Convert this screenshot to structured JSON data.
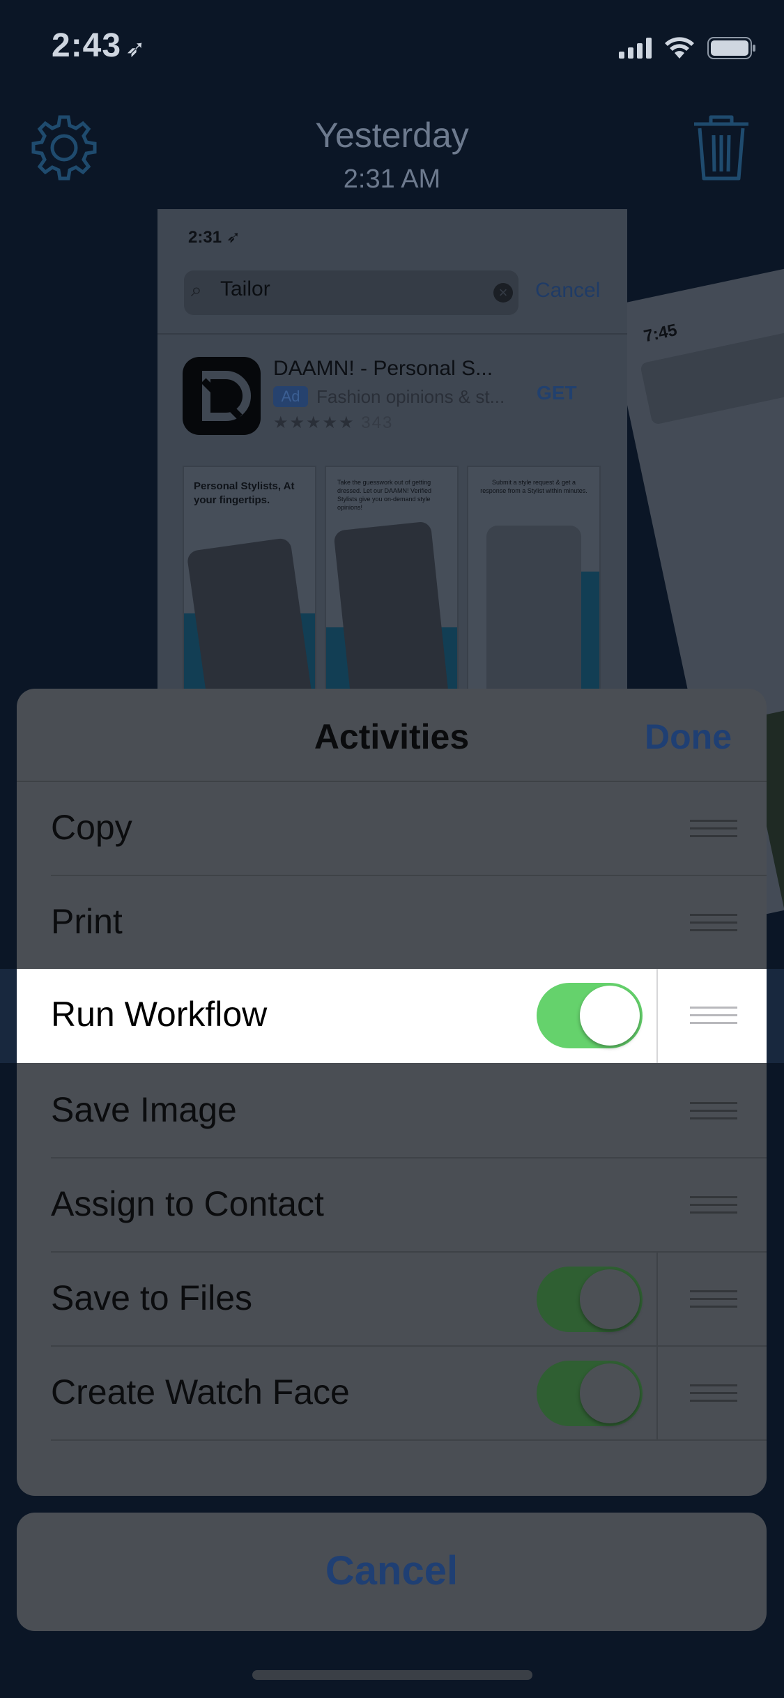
{
  "status_bar": {
    "time": "2:43",
    "location_arrow": "➤"
  },
  "header": {
    "date": "Yesterday",
    "time": "2:31 AM",
    "settings_icon": "gear-icon",
    "delete_icon": "trash-icon"
  },
  "screenshot": {
    "time": "2:31",
    "search_query": "Tailor",
    "cancel_label": "Cancel",
    "app_name": "DAAMN! - Personal S...",
    "ad_label": "Ad",
    "app_subtitle": "Fashion opinions & st...",
    "rating_stars": "★★★★★",
    "rating_count": "343",
    "get_label": "GET",
    "thumb1_text": "Personal Stylists, At your fingertips.",
    "thumb2_text": "Take the guesswork out of getting dressed. Let our DAAMN! Verified Stylists give you on-demand style opinions!",
    "thumb3_text": "Submit a style request & get a response from a Stylist within minutes."
  },
  "screenshot2": {
    "time": "7:45"
  },
  "activities": {
    "title": "Activities",
    "done_label": "Done",
    "items": [
      {
        "label": "Copy",
        "has_toggle": false
      },
      {
        "label": "Print",
        "has_toggle": false
      },
      {
        "label": "Run Workflow",
        "has_toggle": true,
        "enabled": true,
        "highlighted": true
      },
      {
        "label": "Save Image",
        "has_toggle": false
      },
      {
        "label": "Assign to Contact",
        "has_toggle": false
      },
      {
        "label": "Save to Files",
        "has_toggle": true,
        "enabled": true
      },
      {
        "label": "Create Watch Face",
        "has_toggle": true,
        "enabled": true
      }
    ]
  },
  "cancel_label": "Cancel",
  "colors": {
    "accent": "#1f3f73",
    "toggle_on": "#65d26c",
    "highlight_row": "#ffffff"
  }
}
